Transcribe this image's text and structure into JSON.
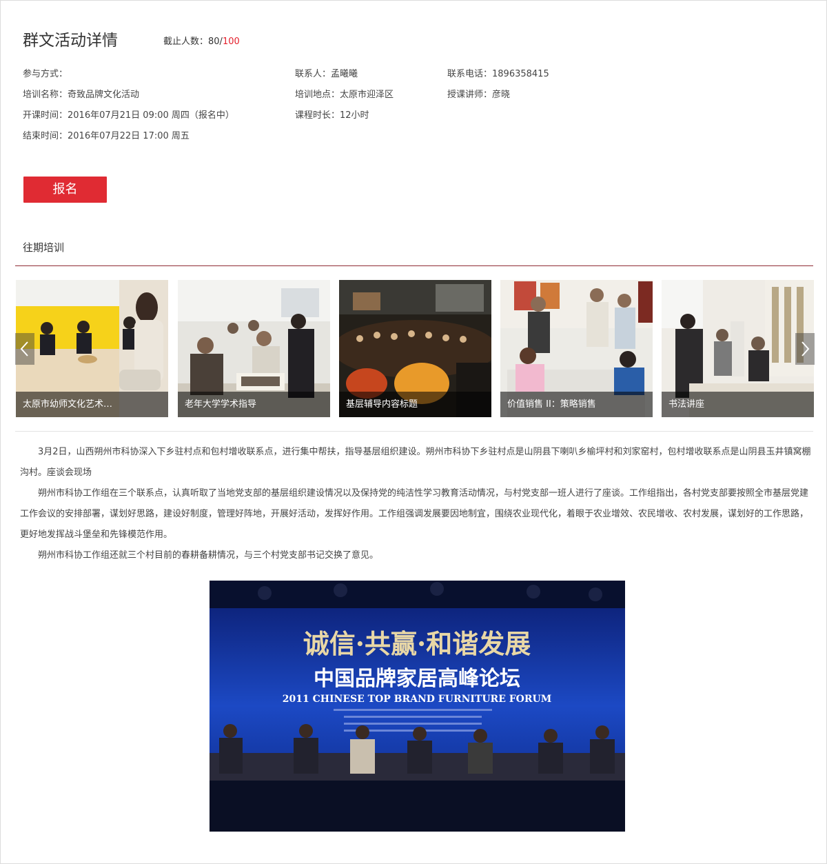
{
  "header": {
    "title": "群文活动详情",
    "capacity_label": "截止人数：",
    "capacity_current": "80/",
    "capacity_max": "100"
  },
  "info": {
    "rows": [
      [
        "参与方式：",
        "联系人：孟曦曦",
        "联系电话：1896358415"
      ],
      [
        "培训名称：奇致品牌文化活动",
        "培训地点：太原市迎泽区",
        "授课讲师：彦晓"
      ],
      [
        "开课时间：2016年07月21日 09:00 周四（报名中）",
        "课程时长：12小时",
        ""
      ],
      [
        "结束时间：2016年07月22日 17:00 周五",
        "",
        ""
      ]
    ]
  },
  "signup_label": "报名",
  "past": {
    "title": "往期培训",
    "cards": [
      {
        "caption": "太原市幼师文化艺术…"
      },
      {
        "caption": "老年大学学术指导"
      },
      {
        "caption": "基层辅导内容标题"
      },
      {
        "caption": "价值销售 II：策略销售"
      },
      {
        "caption": "书法讲座"
      }
    ]
  },
  "article": {
    "paragraphs": [
      "3月2日，山西朔州市科协深入下乡驻村点和包村增收联系点，进行集中帮扶，指导基层组织建设。朔州市科协下乡驻村点是山阴县下喇叭乡榆坪村和刘家窑村，包村增收联系点是山阴县玉井镇窝棚沟村。座谈会现场",
      "朔州市科协工作组在三个联系点，认真听取了当地党支部的基层组织建设情况以及保持党的纯洁性学习教育活动情况，与村党支部一班人进行了座谈。工作组指出，各村党支部要按照全市基层党建工作会议的安排部署，谋划好思路，建设好制度，管理好阵地，开展好活动，发挥好作用。工作组强调发展要因地制宜，围绕农业现代化，着眼于农业增效、农民增收、农村发展，谋划好的工作思路，更好地发挥战斗堡垒和先锋模范作用。",
      "朔州市科协工作组还就三个村目前的春耕备耕情况，与三个村党支部书记交换了意见。"
    ]
  },
  "banner": {
    "slogan": "诚信·共赢·和谐发展",
    "headline": "中国品牌家居高峰论坛",
    "subheadline": "2011 CHINESE TOP BRAND FURNITURE FORUM"
  },
  "colors": {
    "accent": "#e02b33",
    "rule": "#8f2b33"
  },
  "icons": {
    "prev": "chevron-left-icon",
    "next": "chevron-right-icon"
  }
}
